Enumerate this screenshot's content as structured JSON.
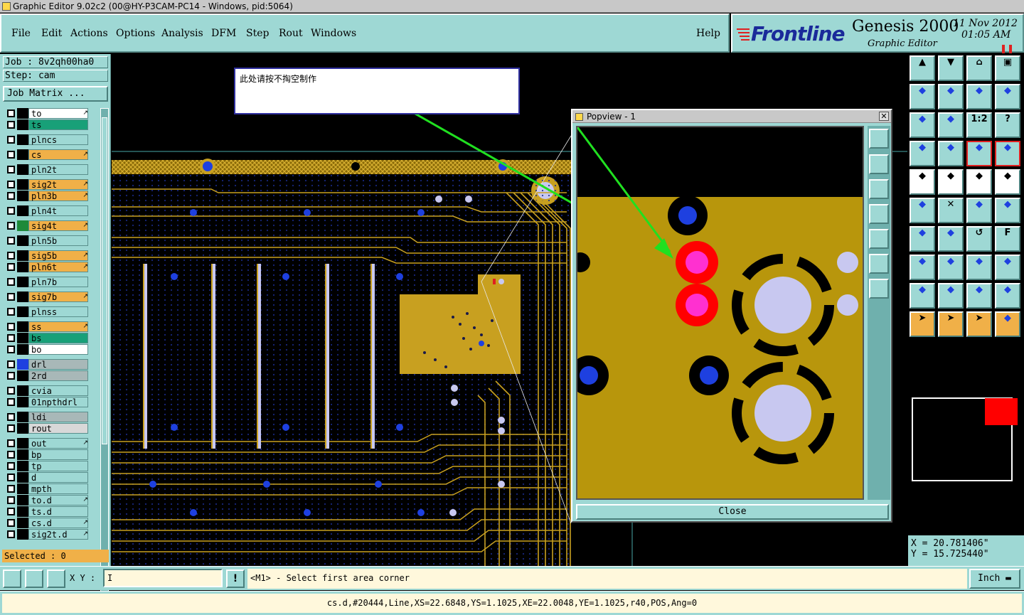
{
  "window": {
    "title": "Graphic Editor 9.02c2 (00@HY-P3CAM-PC14 - Windows, pid:5064)"
  },
  "menu": {
    "items": [
      "File",
      "Edit",
      "Actions",
      "Options",
      "Analysis",
      "DFM",
      "Step",
      "Rout",
      "Windows"
    ],
    "help": "Help"
  },
  "brand": {
    "logo": "Frontline",
    "product": "Genesis 2000",
    "subtitle": "Graphic Editor",
    "date": "11 Nov 2012",
    "time": "01:05 AM"
  },
  "job": {
    "job_label": "Job : 8v2qh00ha0",
    "step_label": "Step: cam",
    "matrix_button": "Job Matrix ..."
  },
  "layers": [
    {
      "name": "to",
      "color": "#ffffff",
      "swatch": "#000000",
      "marker": "↗"
    },
    {
      "name": "ts",
      "color": "#18a078",
      "swatch": "#000000",
      "marker": ""
    },
    {
      "name": "plncs",
      "color": "#9ed8d4",
      "swatch": "#000000",
      "marker": ""
    },
    {
      "name": "cs",
      "color": "#f0b048",
      "swatch": "#000000",
      "marker": "↗"
    },
    {
      "name": "pln2t",
      "color": "#9ed8d4",
      "swatch": "#000000",
      "marker": ""
    },
    {
      "name": "sig2t",
      "color": "#f0b048",
      "swatch": "#000000",
      "marker": "↗"
    },
    {
      "name": "pln3b",
      "color": "#f0b048",
      "swatch": "#000000",
      "marker": "↗"
    },
    {
      "name": "pln4t",
      "color": "#9ed8d4",
      "swatch": "#000000",
      "marker": ""
    },
    {
      "name": "sig4t",
      "color": "#f0b048",
      "swatch": "#1e8a3a",
      "marker": "↗"
    },
    {
      "name": "pln5b",
      "color": "#9ed8d4",
      "swatch": "#000000",
      "marker": ""
    },
    {
      "name": "sig5b",
      "color": "#f0b048",
      "swatch": "#000000",
      "marker": "↗"
    },
    {
      "name": "pln6t",
      "color": "#f0b048",
      "swatch": "#000000",
      "marker": "↗"
    },
    {
      "name": "pln7b",
      "color": "#9ed8d4",
      "swatch": "#000000",
      "marker": ""
    },
    {
      "name": "sig7b",
      "color": "#f0b048",
      "swatch": "#000000",
      "marker": "↗"
    },
    {
      "name": "plnss",
      "color": "#9ed8d4",
      "swatch": "#000000",
      "marker": ""
    },
    {
      "name": "ss",
      "color": "#f0b048",
      "swatch": "#000000",
      "marker": "↗"
    },
    {
      "name": "bs",
      "color": "#18a078",
      "swatch": "#000000",
      "marker": ""
    },
    {
      "name": "bo",
      "color": "#ffffff",
      "swatch": "#000000",
      "marker": ""
    },
    {
      "name": "drl",
      "color": "#a8b8b8",
      "swatch": "#1e40e0",
      "marker": ""
    },
    {
      "name": "2rd",
      "color": "#a8b8b8",
      "swatch": "#000000",
      "marker": ""
    },
    {
      "name": "cvia",
      "color": "#9ed8d4",
      "swatch": "#000000",
      "marker": ""
    },
    {
      "name": "01npthdrl",
      "color": "#9ed8d4",
      "swatch": "#000000",
      "marker": ""
    },
    {
      "name": "ldi",
      "color": "#a8b8b8",
      "swatch": "#000000",
      "marker": ""
    },
    {
      "name": "rout",
      "color": "#d8d8d8",
      "swatch": "#000000",
      "marker": ""
    },
    {
      "name": "out",
      "color": "#9ed8d4",
      "swatch": "#000000",
      "marker": "↗"
    },
    {
      "name": "bp",
      "color": "#9ed8d4",
      "swatch": "#000000",
      "marker": ""
    },
    {
      "name": "tp",
      "color": "#9ed8d4",
      "swatch": "#000000",
      "marker": ""
    },
    {
      "name": "d",
      "color": "#9ed8d4",
      "swatch": "#000000",
      "marker": ""
    },
    {
      "name": "mpth",
      "color": "#9ed8d4",
      "swatch": "#000000",
      "marker": ""
    },
    {
      "name": "to.d",
      "color": "#9ed8d4",
      "swatch": "#000000",
      "marker": "↗"
    },
    {
      "name": "ts.d",
      "color": "#9ed8d4",
      "swatch": "#000000",
      "marker": ""
    },
    {
      "name": "cs.d",
      "color": "#9ed8d4",
      "swatch": "#000000",
      "marker": "↗"
    },
    {
      "name": "sig2t.d",
      "color": "#9ed8d4",
      "swatch": "#000000",
      "marker": "↗"
    }
  ],
  "selected": "Selected : 0",
  "note": {
    "text": "此处请按不掏空制作"
  },
  "popview": {
    "title": "Popview - 1",
    "close_label": "Close",
    "close_x": "✕"
  },
  "coords": {
    "x": "X  =  20.781406\"",
    "y": "Y  =  15.725440\""
  },
  "bottom": {
    "xy_label": "X Y :",
    "xy_value": "I",
    "alert": "!",
    "prompt": "<M1> - Select first area corner",
    "unit": "Inch"
  },
  "status": "cs.d,#20444,Line,XS=22.6848,YS=1.1025,XE=22.0048,YE=1.1025,r40,POS,Ang=0",
  "colors": {
    "panel": "#9ed8d4",
    "copper": "#b8960c",
    "trace": "#c8a020",
    "via_fill": "#1e40e0",
    "pad_light": "#c8c8f0",
    "highlight": "#ff0000",
    "arrow": "#20e020"
  }
}
